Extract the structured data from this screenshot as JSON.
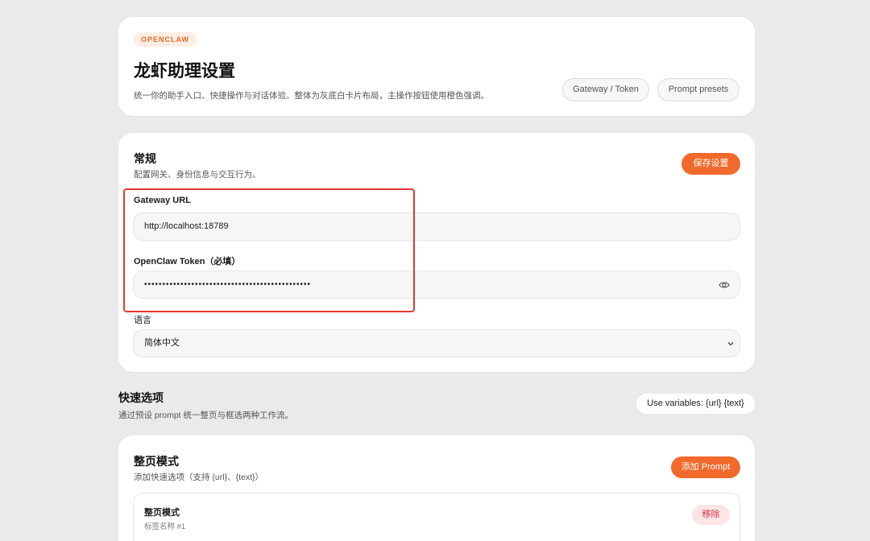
{
  "header": {
    "badge": "OPENCLAW",
    "title": "龙虾助理设置",
    "description": "统一你的助手入口、快捷操作与对话体验。整体为灰底白卡片布局，主操作按钮使用橙色强调。",
    "buttons": [
      "Gateway / Token",
      "Prompt presets"
    ]
  },
  "general": {
    "title": "常规",
    "description": "配置网关、身份信息与交互行为。",
    "save_label": "保存设置",
    "gateway_label": "Gateway URL",
    "gateway_value": "http://localhost:18789",
    "token_label": "OpenClaw Token（必填）",
    "token_value": "••••••••••••••••••••••••••••••••••••••••••••••",
    "language_label": "语言",
    "language_value": "简体中文"
  },
  "quick_options": {
    "title": "快速选项",
    "description": "通过预设 prompt 统一整页与框选两种工作流。",
    "vars_label": "Use variables: {url} {text}"
  },
  "full_page": {
    "title": "整页模式",
    "description": "添加快速选项（支持 {url}、{text}）",
    "add_label": "添加 Prompt",
    "item_title": "整页模式",
    "item_subtitle": "标签名称 #1",
    "remove_label": "移除"
  },
  "colors": {
    "accent": "#f26a2b",
    "highlight": "#e2382f",
    "background": "#eaeaec"
  }
}
